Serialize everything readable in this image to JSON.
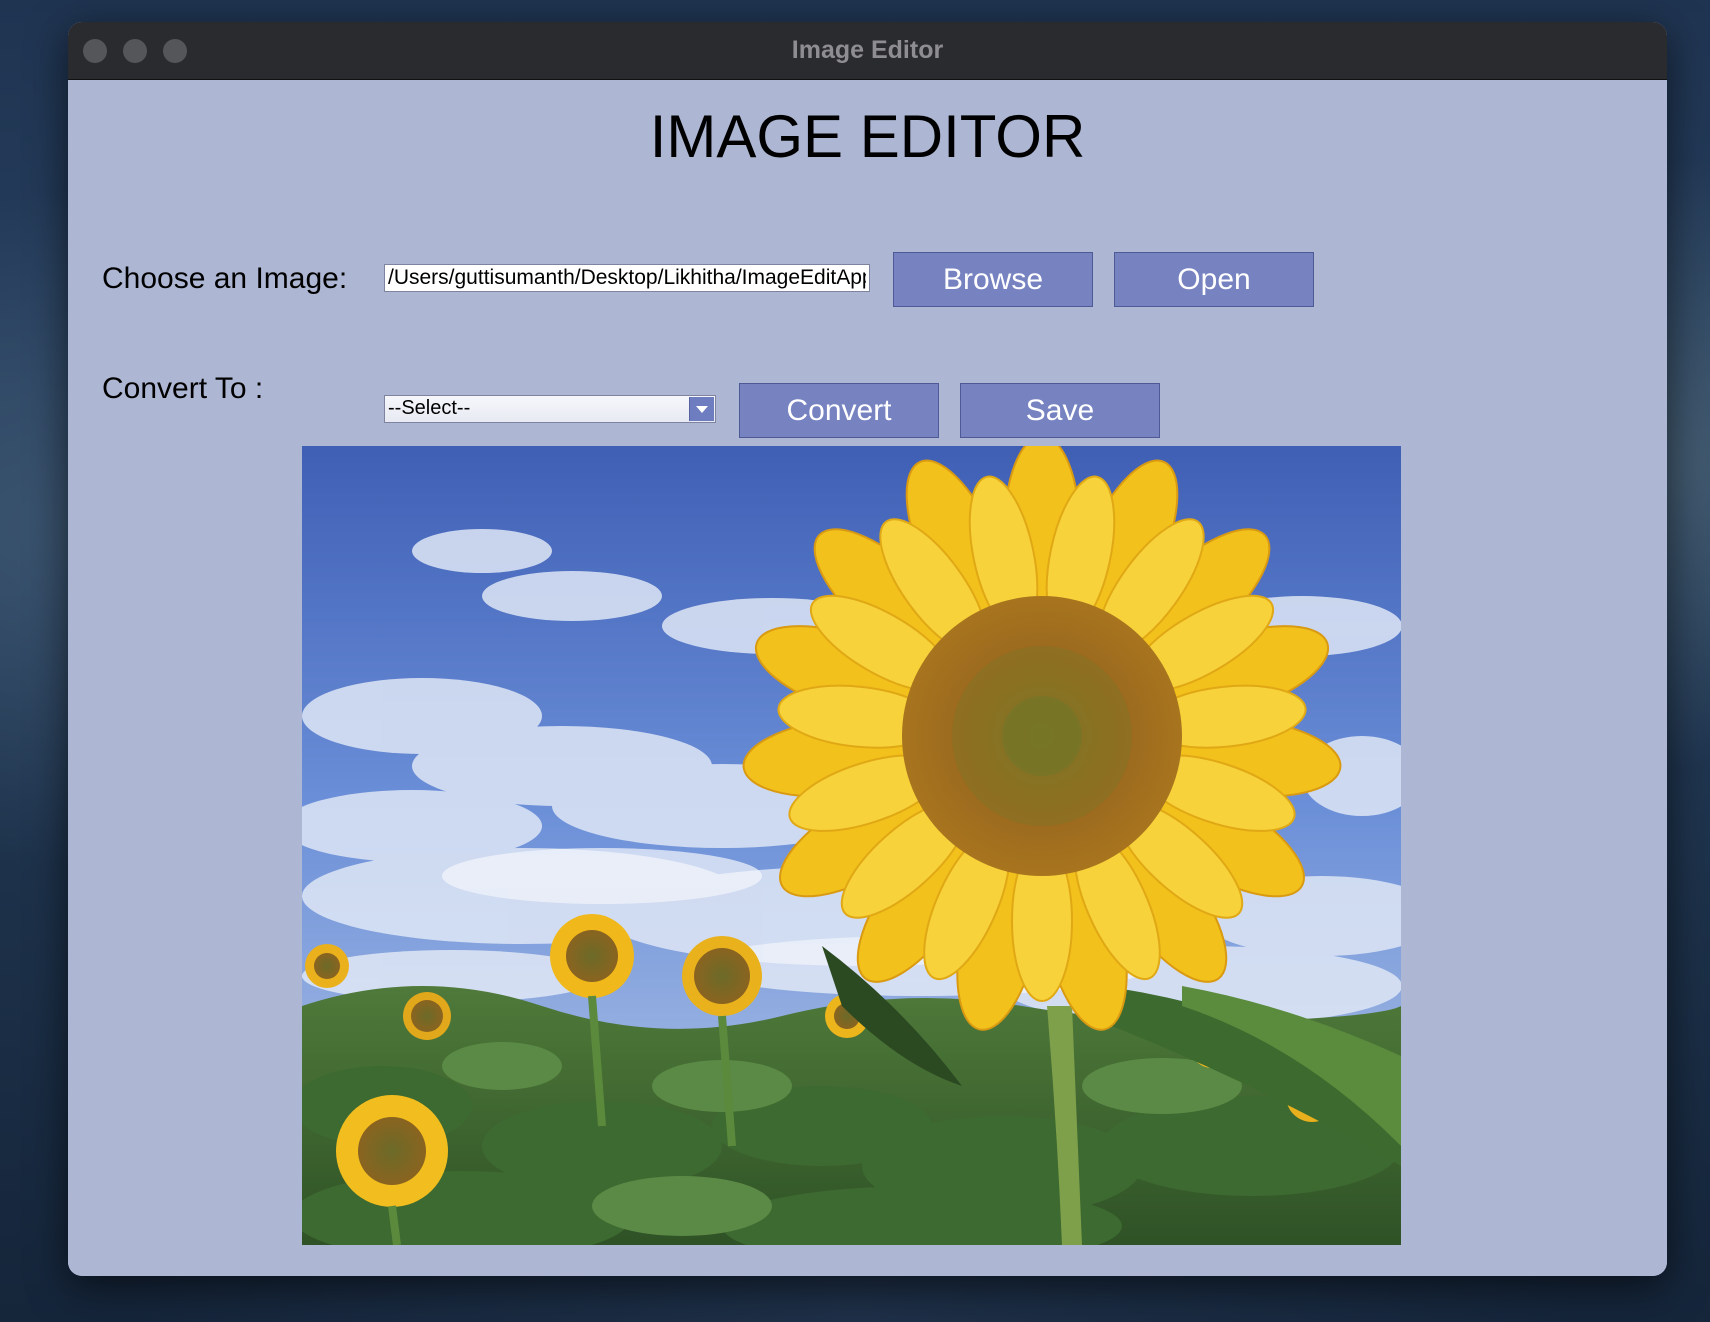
{
  "window": {
    "title": "Image Editor"
  },
  "app": {
    "heading": "IMAGE EDITOR"
  },
  "choose": {
    "label": "Choose an Image:",
    "path_value": "/Users/guttisumanth/Desktop/Likhitha/ImageEditApp",
    "browse_label": "Browse",
    "open_label": "Open"
  },
  "convert": {
    "label": "Convert To :",
    "selected_option": "--Select--",
    "convert_label": "Convert",
    "save_label": "Save"
  },
  "preview": {
    "subject": "sunflower field under blue sky"
  },
  "colors": {
    "panel_bg": "#adb6d3",
    "button_bg": "#7783c1",
    "titlebar_bg": "#2a2b2e",
    "sky_top": "#3f5fb5",
    "petal": "#f2c11c"
  }
}
